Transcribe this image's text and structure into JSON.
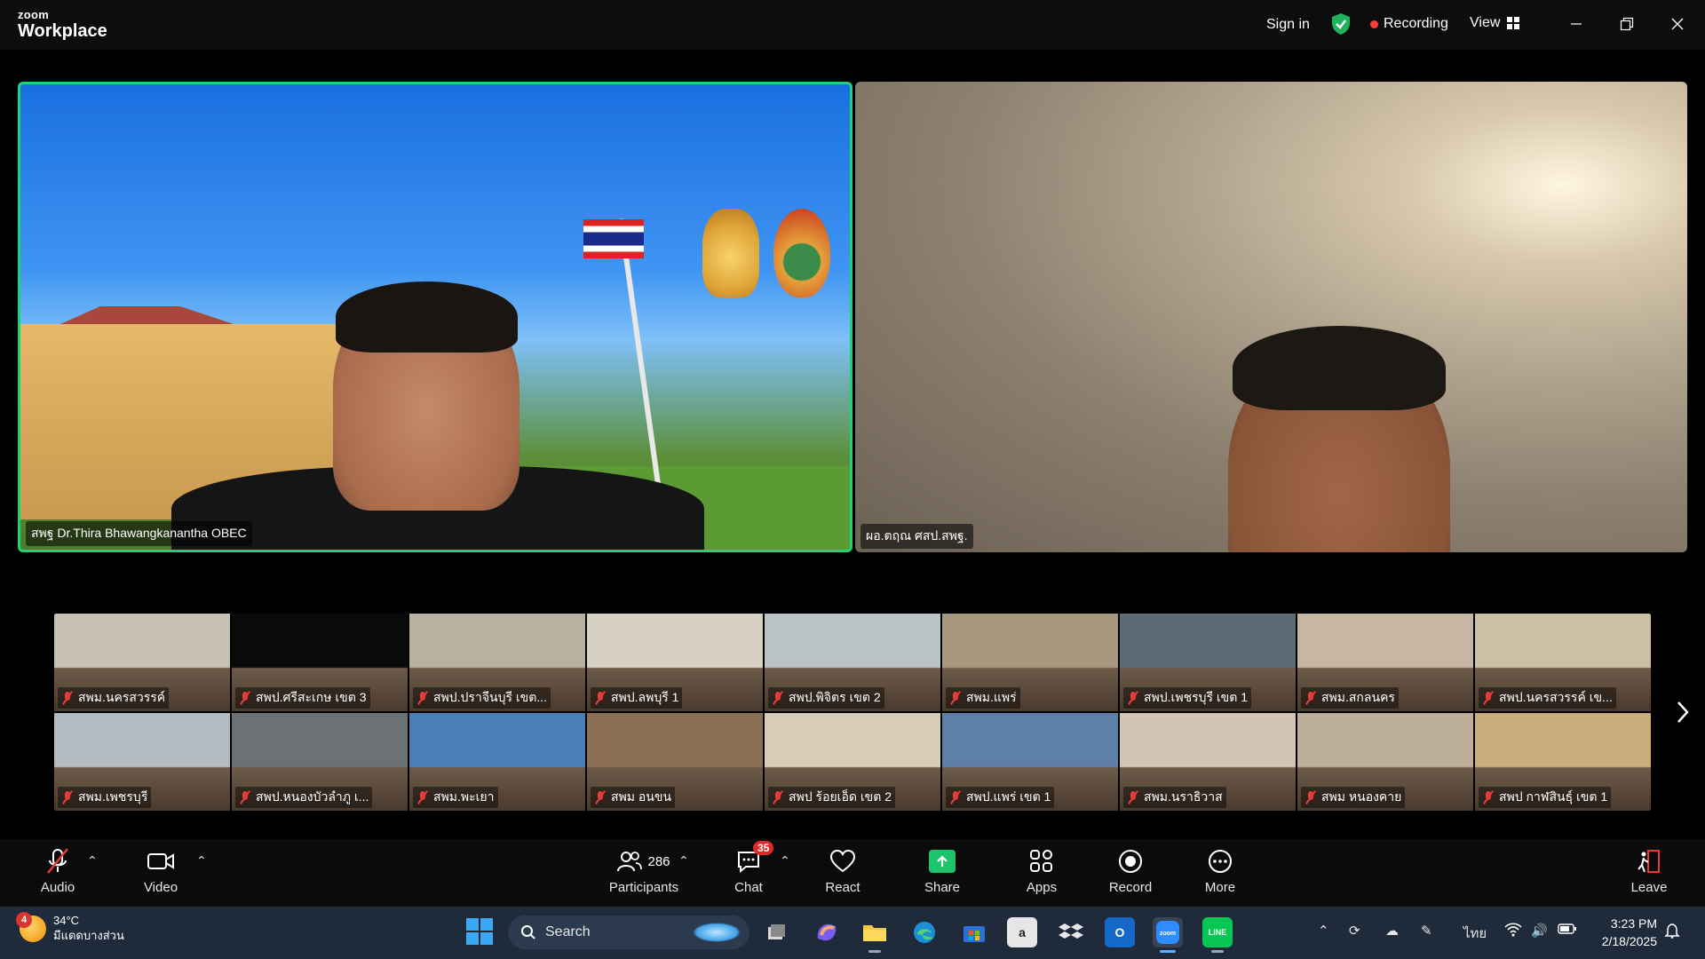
{
  "titlebar": {
    "brand_top": "zoom",
    "brand_bottom": "Workplace",
    "sign_in": "Sign in",
    "recording": "Recording",
    "view": "View"
  },
  "main_videos": [
    {
      "name": "สพฐ Dr.Thira Bhawangkanantha OBEC",
      "active_speaker": true
    },
    {
      "name": "ผอ.ตฤณ ศสป.สพฐ.",
      "active_speaker": false
    }
  ],
  "thumbnails": [
    {
      "name": "สพม.นครสวรรค์",
      "color": "#c9c2b4"
    },
    {
      "name": "สพป.ศรีสะเกษ เขต 3",
      "color": "#0a0a0a"
    },
    {
      "name": "สพป.ปราจีนบุรี เขต...",
      "color": "#b9b0a0"
    },
    {
      "name": "สพป.ลพบุรี 1",
      "color": "#d6d1c4"
    },
    {
      "name": "สพป.พิจิตร เขต 2",
      "color": "#bcc3c7"
    },
    {
      "name": "สพม.แพร่",
      "color": "#a99880"
    },
    {
      "name": "สพป.เพชรบุรี เขต 1",
      "color": "#5d6b74"
    },
    {
      "name": "สพม.สกลนคร",
      "color": "#c8b6a4"
    },
    {
      "name": "สพป.นครสวรรค์ เข...",
      "color": "#cdbfa3"
    },
    {
      "name": "สพม.เพชรบุรี",
      "color": "#b4bcc2"
    },
    {
      "name": "สพป.หนองบัวลำภู เ...",
      "color": "#6b7175"
    },
    {
      "name": "สพม.พะเยา",
      "color": "#4a7fb8"
    },
    {
      "name": "สพม อนขน",
      "color": "#8a6f55"
    },
    {
      "name": "สพป ร้อยเอ็ด เขต 2",
      "color": "#d6ccb8"
    },
    {
      "name": "สพป.แพร่ เขต 1",
      "color": "#5e7fa8"
    },
    {
      "name": "สพม.นราธิวาส",
      "color": "#d3c4b3"
    },
    {
      "name": "สพม หนองคาย",
      "color": "#bcae98"
    },
    {
      "name": "สพป กาฬสินธุ์ เขต 1",
      "color": "#c9ae7c"
    }
  ],
  "toolbar": {
    "audio": "Audio",
    "video": "Video",
    "participants": "Participants",
    "participant_count": "286",
    "chat": "Chat",
    "chat_badge": "35",
    "react": "React",
    "share": "Share",
    "apps": "Apps",
    "record": "Record",
    "more": "More",
    "leave": "Leave"
  },
  "taskbar": {
    "weather_badge": "4",
    "temperature": "34°C",
    "condition": "มีแดดบางส่วน",
    "search": "Search",
    "language": "ไทย",
    "time": "3:23 PM",
    "date": "2/18/2025"
  }
}
